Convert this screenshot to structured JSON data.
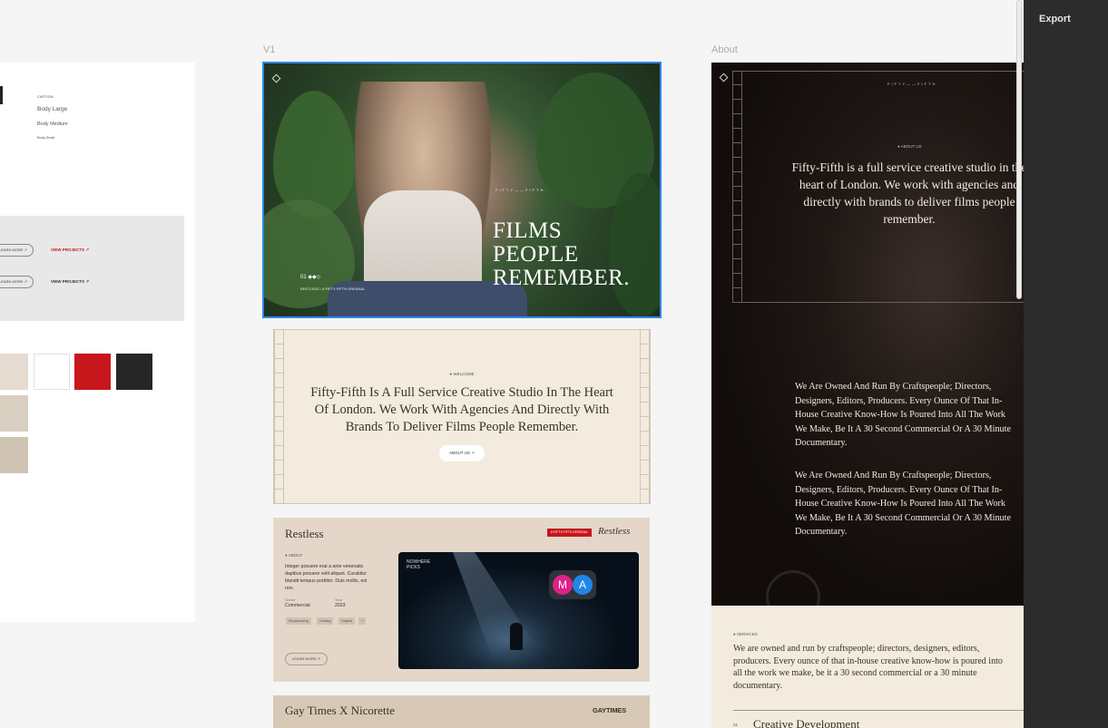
{
  "canvas": {
    "frames": [
      {
        "label": "V1"
      },
      {
        "label": "About"
      }
    ]
  },
  "styleguide": {
    "caption": "CAPTION",
    "body_large": "Body Large",
    "body_medium": "Body Medium",
    "body_small": "Body Small",
    "learn_more": "LEARN MORE ↗",
    "view_projects": "VIEW PROJECTS ↗",
    "swatches": [
      "#e6dbd1",
      "#ffffff",
      "#c8161d",
      "#262626",
      "#d9cfc0",
      "#cfc4b3"
    ]
  },
  "hero": {
    "brand": "FIFTY——FIFTH",
    "title": "FILMS\nPEOPLE\nREMEMBER.",
    "dots": "01  ◆◆◇",
    "subtitle": "RESTLESS / A FIFTY-FIFTH ORIGINAL"
  },
  "welcome": {
    "eyebrow": "● WELCOME",
    "text": "Fifty-Fifth Is A Full Service Creative Studio In The Heart Of London. We Work With Agencies And Directly With Brands To Deliver Films People Remember.",
    "button": "ABOUT US ↗"
  },
  "restless": {
    "title": "Restless",
    "badge": "A FIFTY-FIFTH ORIGINAL",
    "logo": "Restless",
    "about_label": "● ABOUT",
    "body": "Integer posuere erat a ante venenatis dapibus posuere velit aliquet. Curabitur blandit tempus porttitor. Duis mollis, est non.",
    "sector_label": "Sector",
    "sector_value": "Commercial",
    "year_label": "Year",
    "year_value": "2023",
    "tags": [
      "Storyboarding",
      "Grading",
      "Original",
      "+"
    ],
    "learn_more": "LEARN MORE ↗",
    "video_label": "NOWHERE\nPICKS",
    "avatars": [
      {
        "initial": "M",
        "color": "#e0208a"
      },
      {
        "initial": "A",
        "color": "#1f86e8"
      }
    ]
  },
  "gaytimes": {
    "title": "Gay Times X Nicorette",
    "logo": "GAYTIMES"
  },
  "about": {
    "brand": "FIFTY——FIFTH",
    "eyebrow": "● ABOUT US",
    "text": "Fifty-Fifth is a full service creative studio in the heart of London. We work with agencies and directly with brands to deliver films people remember.",
    "paragraphs": [
      "We Are Owned And Run By Craftspeople; Directors, Designers, Editors, Producers. Every Ounce Of That In-House Creative Know-How Is Poured Into All The Work We Make, Be It A 30 Second Commercial Or A 30 Minute Documentary.",
      "We Are Owned And Run By Craftspeople; Directors, Designers, Editors, Producers. Every Ounce Of That In-House Creative Know-How Is Poured Into All The Work We Make, Be It A 30 Second Commercial Or A 30 Minute Documentary."
    ]
  },
  "services": {
    "eyebrow": "● SERVICES",
    "body": "We are owned and run by craftspeople; directors, designers, editors, producers. Every ounce of that in-house creative know-how is poured into all the work we make, be it a 30 second commercial or a 30 minute documentary.",
    "item_number": "01",
    "item_title": "Creative Development"
  },
  "panel": {
    "export_label": "Export"
  }
}
